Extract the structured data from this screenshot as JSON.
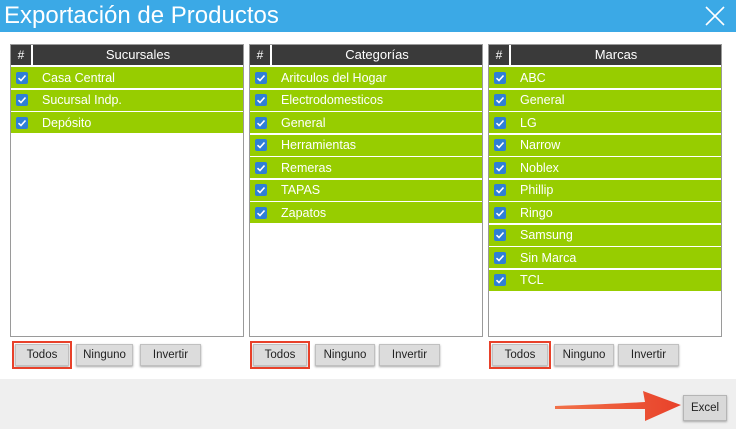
{
  "dialog": {
    "title": "Exportación de Productos",
    "close_icon": "close-icon"
  },
  "colors": {
    "title_bar": "#3ba9e6",
    "row_checked": "#97cd00",
    "header": "#3a3a3a",
    "checkbox": "#2f7fd6",
    "highlight": "#e8412a"
  },
  "sucursales": {
    "col_hash": "#",
    "title": "Sucursales",
    "items": [
      {
        "label": "Casa Central",
        "checked": true
      },
      {
        "label": "Sucursal Indp.",
        "checked": true
      },
      {
        "label": "Depósito",
        "checked": true
      }
    ]
  },
  "categorias": {
    "col_hash": "#",
    "title": "Categorías",
    "items": [
      {
        "label": "Aritculos del Hogar",
        "checked": true
      },
      {
        "label": "Electrodomesticos",
        "checked": true
      },
      {
        "label": "General",
        "checked": true
      },
      {
        "label": "Herramientas",
        "checked": true
      },
      {
        "label": "Remeras",
        "checked": true
      },
      {
        "label": "TAPAS",
        "checked": true
      },
      {
        "label": "Zapatos",
        "checked": true
      }
    ]
  },
  "marcas": {
    "col_hash": "#",
    "title": "Marcas",
    "items": [
      {
        "label": "ABC",
        "checked": true
      },
      {
        "label": "General",
        "checked": true
      },
      {
        "label": "LG",
        "checked": true
      },
      {
        "label": "Narrow",
        "checked": true
      },
      {
        "label": "Noblex",
        "checked": true
      },
      {
        "label": "Phillip",
        "checked": true
      },
      {
        "label": "Ringo",
        "checked": true
      },
      {
        "label": "Samsung",
        "checked": true
      },
      {
        "label": "Sin Marca",
        "checked": true
      },
      {
        "label": "TCL",
        "checked": true
      }
    ]
  },
  "buttons": {
    "todos": "Todos",
    "ninguno": "Ninguno",
    "invertir": "Invertir"
  },
  "footer": {
    "excel_label": "Excel"
  }
}
